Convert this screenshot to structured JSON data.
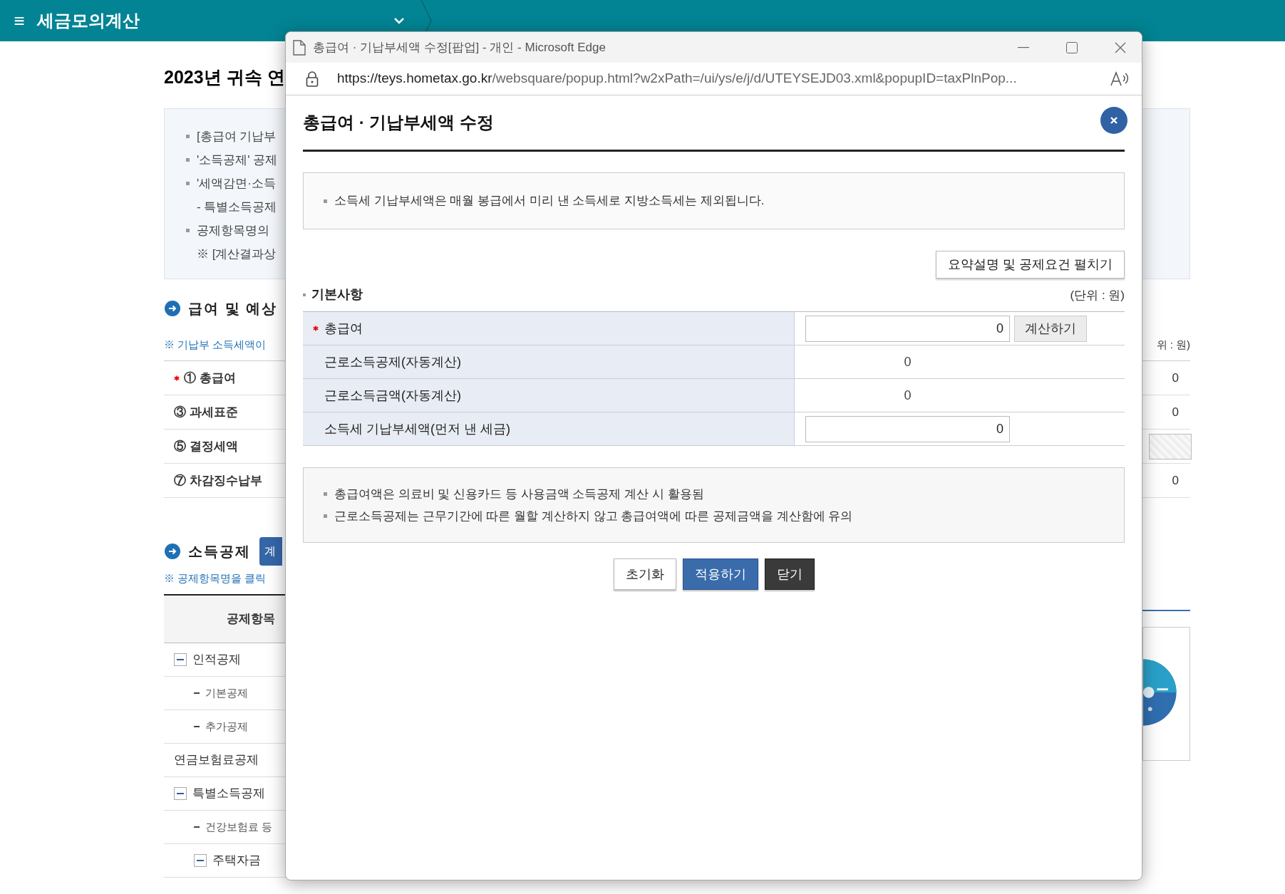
{
  "app_bar": {
    "title": "세금모의계산",
    "menu_glyph": "≡"
  },
  "page": {
    "heading": "2023년 귀속 연",
    "notes": [
      {
        "text": "[총급여 기납부",
        "kind": "bullet"
      },
      {
        "text": "'소득공제' 공제",
        "kind": "bullet"
      },
      {
        "text": "'세액감면·소득",
        "kind": "bullet"
      },
      {
        "text": "- 특별소득공제",
        "kind": "sub"
      },
      {
        "text": "공제항목명의",
        "kind": "bullet"
      },
      {
        "text": "※ [계산결과상",
        "kind": "sub"
      }
    ],
    "section_1": {
      "title": "급여 및 예상",
      "hint": "※ 기납부 소득세액이",
      "unit": "위 : 원)",
      "rows": [
        {
          "label": "① 총급여",
          "required": true,
          "kind": "value",
          "value": "0"
        },
        {
          "label": "③ 과세표준",
          "required": false,
          "kind": "value",
          "value": "0"
        },
        {
          "label": "⑤ 결정세액",
          "required": false,
          "kind": "blank"
        },
        {
          "label": "⑦ 차감징수납부",
          "required": false,
          "kind": "value",
          "value": "0"
        }
      ]
    },
    "section_2": {
      "title": "소득공제",
      "button": "계",
      "hint": "※ 공제항목명을 클릭",
      "table_header": "공제항목",
      "rows": [
        {
          "label": "인적공제",
          "expanded": true,
          "children": [
            {
              "label": "기본공제"
            },
            {
              "label": "추가공제"
            }
          ]
        },
        {
          "label": "연금보험료공제"
        },
        {
          "label": "특별소득공제",
          "expanded": true,
          "children": [
            {
              "label": "건강보험료 등"
            },
            {
              "label": "주택자금",
              "expanded": true
            }
          ]
        }
      ]
    }
  },
  "popup_window": {
    "title": "총급여 · 기납부세액 수정[팝업] - 개인 - Microsoft Edge",
    "url_host": "https://teys.hometax.go.kr",
    "url_path": "/websquare/popup.html?w2xPath=/ui/ys/e/j/d/UTEYSEJD03.xml&popupID=taxPlnPop...",
    "dialog": {
      "title": "총급여 · 기납부세액 수정",
      "notice": [
        "소득세 기납부세액은 매월 봉급에서 미리 낸 소득세로 지방소득세는 제외됩니다."
      ],
      "toggle_button": "요약설명 및 공제요건 펼치기",
      "section": "기본사항",
      "unit": "(단위 : 원)",
      "rows": [
        {
          "label": "총급여",
          "required": true,
          "kind": "input",
          "value": "0",
          "button": "계산하기"
        },
        {
          "label": "근로소득공제(자동계산)",
          "required": false,
          "kind": "text",
          "value": "0"
        },
        {
          "label": "근로소득금액(자동계산)",
          "required": false,
          "kind": "text",
          "value": "0"
        },
        {
          "label": "소득세 기납부세액(먼저 낸 세금)",
          "required": false,
          "kind": "input",
          "value": "0"
        }
      ],
      "notes": [
        "총급여액은 의료비 및 신용카드 등 사용금액 소득공제 계산 시 활용됨",
        "근로소득공제는 근무기간에 따른 월할 계산하지 않고 총급여액에 따른 공제금액을 계산함에 유의"
      ],
      "buttons": [
        {
          "label": "초기화",
          "kind": "default"
        },
        {
          "label": "적용하기",
          "kind": "primary"
        },
        {
          "label": "닫기",
          "kind": "dark"
        }
      ]
    }
  }
}
